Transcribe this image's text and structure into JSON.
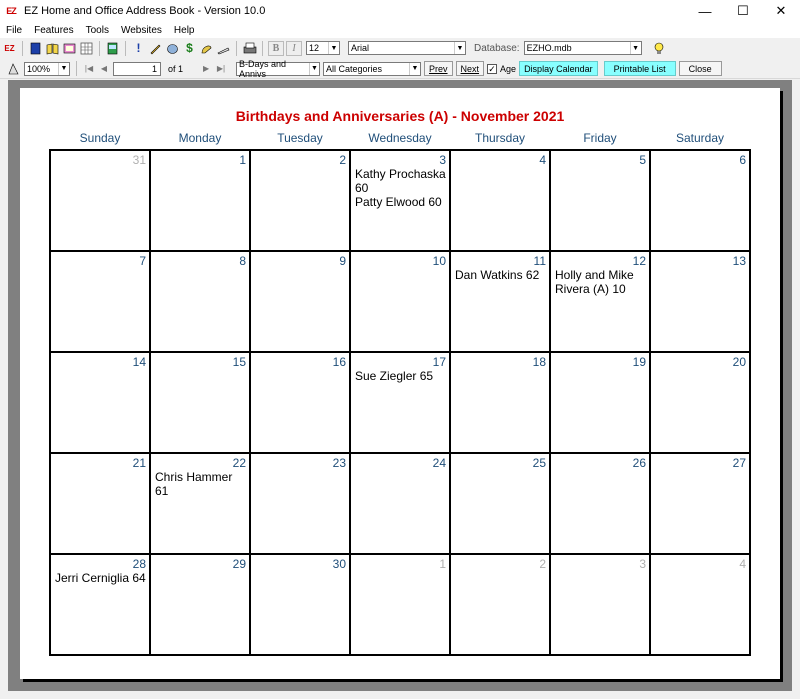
{
  "window": {
    "title": "EZ Home and Office Address Book - Version 10.0",
    "app_icon_text": "EZ"
  },
  "menu": [
    "File",
    "Features",
    "Tools",
    "Websites",
    "Help"
  ],
  "toolbar1": {
    "bold_label": "B",
    "italic_label": "I",
    "font_size": "12",
    "font_name": "Arial",
    "database_label": "Database:",
    "database_value": "EZHO.mdb"
  },
  "toolbar2": {
    "zoom": "100%",
    "page_number": "1",
    "page_of": "of 1",
    "report_type": "B-Days and Annivs",
    "category": "All Categories",
    "prev_label": "Prev",
    "next_label": "Next",
    "age_label": "Age",
    "age_checked": "✓",
    "display_calendar_label": "Display Calendar",
    "printable_list_label": "Printable List",
    "close_label": "Close"
  },
  "calendar": {
    "title": "Birthdays and Anniversaries (A) - November 2021",
    "days_of_week": [
      "Sunday",
      "Monday",
      "Tuesday",
      "Wednesday",
      "Thursday",
      "Friday",
      "Saturday"
    ],
    "weeks": [
      [
        {
          "day": "31",
          "other": true,
          "events": []
        },
        {
          "day": "1",
          "events": []
        },
        {
          "day": "2",
          "events": []
        },
        {
          "day": "3",
          "events": [
            "Kathy Prochaska 60",
            "Patty Elwood 60"
          ]
        },
        {
          "day": "4",
          "events": []
        },
        {
          "day": "5",
          "events": []
        },
        {
          "day": "6",
          "events": []
        }
      ],
      [
        {
          "day": "7",
          "events": []
        },
        {
          "day": "8",
          "events": []
        },
        {
          "day": "9",
          "events": []
        },
        {
          "day": "10",
          "events": []
        },
        {
          "day": "11",
          "events": [
            "Dan Watkins 62"
          ]
        },
        {
          "day": "12",
          "events": [
            "Holly and Mike Rivera (A) 10"
          ]
        },
        {
          "day": "13",
          "events": []
        }
      ],
      [
        {
          "day": "14",
          "events": []
        },
        {
          "day": "15",
          "events": []
        },
        {
          "day": "16",
          "events": []
        },
        {
          "day": "17",
          "events": [
            "Sue Ziegler 65"
          ]
        },
        {
          "day": "18",
          "events": []
        },
        {
          "day": "19",
          "events": []
        },
        {
          "day": "20",
          "events": []
        }
      ],
      [
        {
          "day": "21",
          "events": []
        },
        {
          "day": "22",
          "events": [
            "Chris Hammer 61"
          ]
        },
        {
          "day": "23",
          "events": []
        },
        {
          "day": "24",
          "events": []
        },
        {
          "day": "25",
          "events": []
        },
        {
          "day": "26",
          "events": []
        },
        {
          "day": "27",
          "events": []
        }
      ],
      [
        {
          "day": "28",
          "events": [
            "Jerri Cerniglia 64"
          ]
        },
        {
          "day": "29",
          "events": []
        },
        {
          "day": "30",
          "events": []
        },
        {
          "day": "1",
          "other": true,
          "events": []
        },
        {
          "day": "2",
          "other": true,
          "events": []
        },
        {
          "day": "3",
          "other": true,
          "events": []
        },
        {
          "day": "4",
          "other": true,
          "events": []
        }
      ]
    ]
  },
  "colors": {
    "title_red": "#cc0000",
    "day_blue": "#1f4e79",
    "other_month_gray": "#b0b0b0",
    "button_cyan": "#88ffff"
  }
}
